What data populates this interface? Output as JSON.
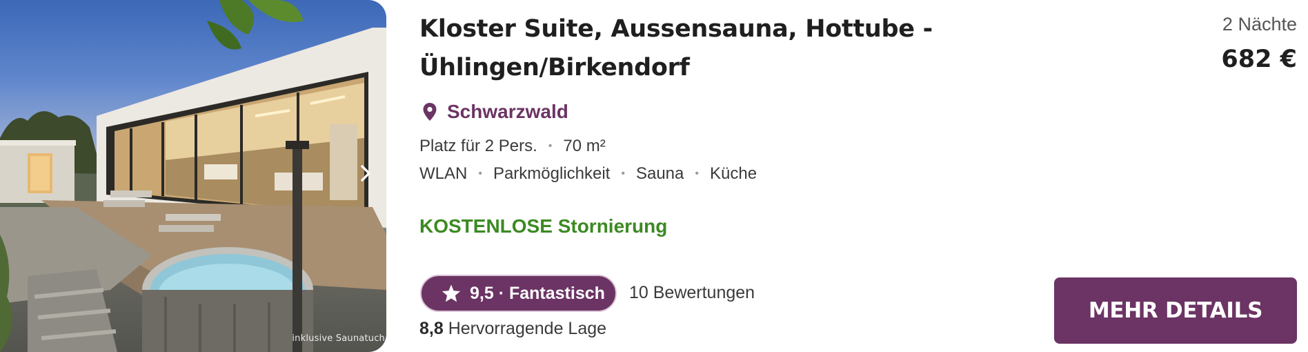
{
  "listing": {
    "title_line1": "Kloster Suite, Aussensauna, Hottube -",
    "title_line2": "Ühlingen/Birkendorf",
    "location": "Schwarzwald",
    "capacity": "Platz für 2 Pers.",
    "size": "70 m²",
    "amenities": [
      "WLAN",
      "Parkmöglichkeit",
      "Sauna",
      "Küche"
    ],
    "cancellation": "KOSTENLOSE Stornierung",
    "photo_caption": "inklusive Saunatuch"
  },
  "rating": {
    "badge_label": "9,5 · Fantastisch",
    "reviews_label": "10 Bewertungen",
    "location_score": "8,8",
    "location_label": "Hervorragende Lage"
  },
  "price": {
    "nights_label": "2 Nächte",
    "amount_label": "682 €"
  },
  "actions": {
    "details_label": "MEHR DETAILS"
  },
  "icons": {
    "location": "map-pin-icon",
    "rating": "star-icon",
    "next": "chevron-right-icon"
  },
  "colors": {
    "brand": "#6b3464",
    "cancellation": "#3b8a22",
    "text": "#2b2b2b"
  }
}
